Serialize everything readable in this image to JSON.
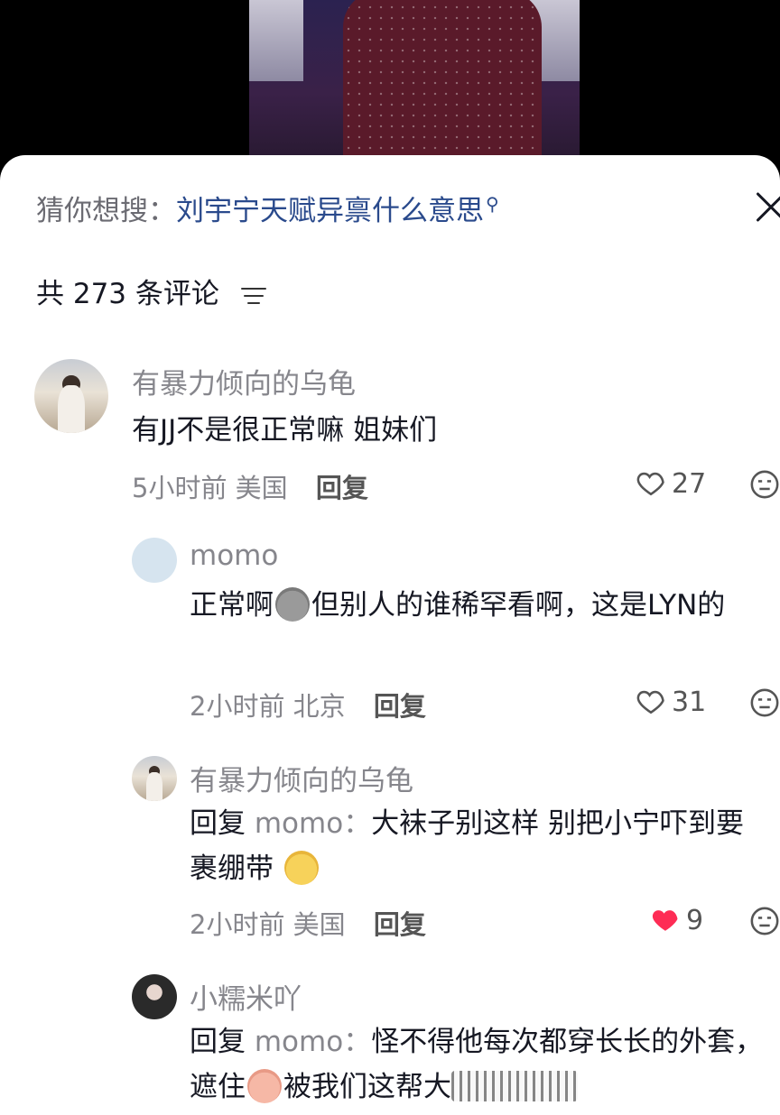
{
  "search_suggestion": {
    "label": "猜你想搜：",
    "term": "刘宇宁天赋异禀什么意思",
    "icon": "search-icon"
  },
  "comments_header": {
    "count_text": "共 273 条评论",
    "filter_icon": "sort-filter-icon"
  },
  "comments": [
    {
      "username": "有暴力倾向的乌龟",
      "text": "有JJ不是很正常嘛 姐妹们",
      "time": "5小时前",
      "location": "美国",
      "reply_label": "回复",
      "likes": "27",
      "liked": false
    },
    {
      "username": "momo",
      "text_before": "正常啊",
      "emoji": "gray-face-emoji",
      "text_after": "但别人的谁稀罕看啊，这是LYN的",
      "time": "2小时前",
      "location": "北京",
      "reply_label": "回复",
      "likes": "31",
      "liked": false
    },
    {
      "username": "有暴力倾向的乌龟",
      "reply_prefix": "回复",
      "reply_to": "momo：",
      "text": "大袜子别这样 别把小宁吓到要裹绷带",
      "emoji": "yellow-face-emoji",
      "time": "2小时前",
      "location": "美国",
      "reply_label": "回复",
      "likes": "9",
      "liked": true
    },
    {
      "username": "小糯米吖",
      "reply_prefix": "回复",
      "reply_to": "momo：",
      "text_before": "怪不得他每次都穿长长的外套，遮住",
      "emoji": "crying-laugh-emoji",
      "text_after": "被我们这帮大",
      "truncated": true
    }
  ],
  "colors": {
    "username": "#86868c",
    "link": "#2a4a8c",
    "text": "#161823",
    "liked_heart": "#fe2c55"
  }
}
